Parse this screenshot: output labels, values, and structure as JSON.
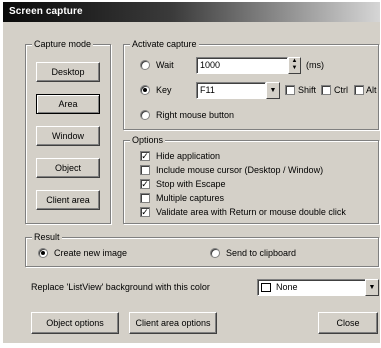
{
  "window": {
    "title": "Screen capture"
  },
  "capture_mode": {
    "legend": "Capture mode",
    "buttons": [
      "Desktop",
      "Area",
      "Window",
      "Object",
      "Client area"
    ],
    "selected": "Area"
  },
  "activate_capture": {
    "legend": "Activate capture",
    "wait_label": "Wait",
    "wait_value": "1000",
    "wait_unit": "(ms)",
    "key_label": "Key",
    "key_value": "F11",
    "shift_label": "Shift",
    "ctrl_label": "Ctrl",
    "alt_label": "Alt",
    "shift_checked": false,
    "ctrl_checked": false,
    "alt_checked": false,
    "right_mouse_label": "Right mouse button",
    "selected": "Key"
  },
  "options": {
    "legend": "Options",
    "items": [
      {
        "label": "Hide application",
        "checked": true
      },
      {
        "label": "Include mouse cursor (Desktop / Window)",
        "checked": false
      },
      {
        "label": "Stop with Escape",
        "checked": true
      },
      {
        "label": "Multiple captures",
        "checked": false
      },
      {
        "label": "Validate area with Return or mouse double click",
        "checked": true
      }
    ]
  },
  "result": {
    "legend": "Result",
    "create_label": "Create new image",
    "clipboard_label": "Send to clipboard",
    "selected": "Create new image"
  },
  "listview": {
    "label": "Replace 'ListView' background with this color",
    "value": "None"
  },
  "footer": {
    "object_options": "Object options",
    "client_area_options": "Client area options",
    "close": "Close"
  },
  "glyphs": {
    "check": "✓",
    "spin_up": "▲",
    "spin_down": "▼",
    "dropdown": "▼"
  }
}
